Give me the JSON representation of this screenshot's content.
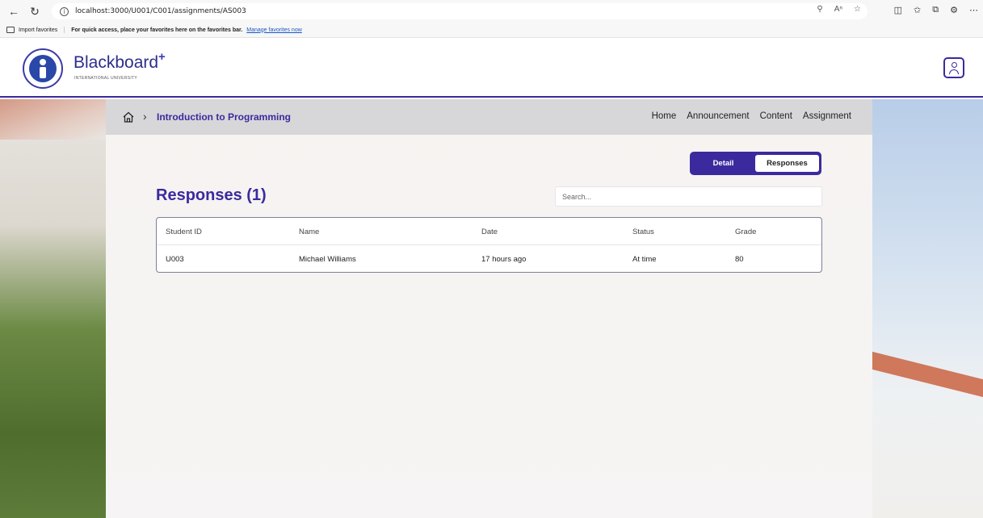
{
  "browser": {
    "url": "localhost:3000/U001/C001/assignments/AS003",
    "favorites": {
      "import_label": "Import favorites",
      "message": "For quick access, place your favorites here on the favorites bar.",
      "manage_link": "Manage favorites now"
    }
  },
  "header": {
    "brand": "Blackboard",
    "brand_plus": "+",
    "brand_sub": "INTERNATIONAL UNIVERSITY"
  },
  "breadcrumb": {
    "course": "Introduction to Programming"
  },
  "nav": {
    "items": [
      "Home",
      "Announcement",
      "Content",
      "Assignment"
    ]
  },
  "tabs": {
    "detail": "Detail",
    "responses": "Responses"
  },
  "main": {
    "title": "Responses (1)",
    "search_placeholder": "Search..."
  },
  "table": {
    "headers": [
      "Student ID",
      "Name",
      "Date",
      "Status",
      "Grade"
    ],
    "rows": [
      [
        "U003",
        "Michael Williams",
        "17 hours ago",
        "At time",
        "80"
      ]
    ]
  },
  "colors": {
    "accent": "#3b2a9e"
  }
}
